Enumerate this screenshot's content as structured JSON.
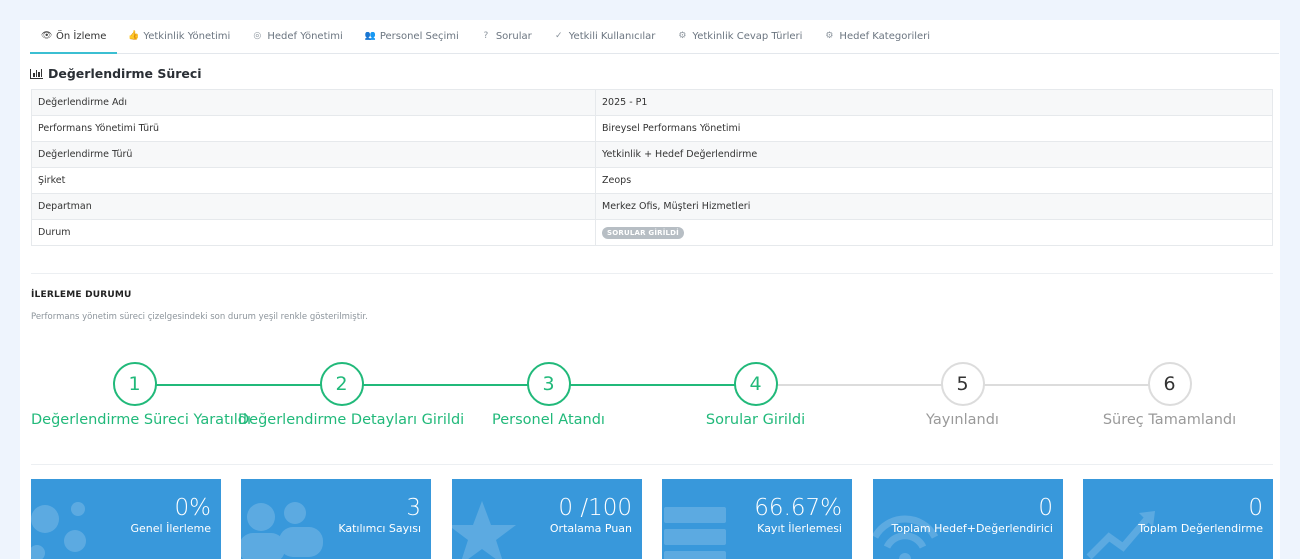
{
  "tabs": [
    {
      "label": "Ön İzleme",
      "icon": "eye-icon",
      "glyph": "👁",
      "active": true
    },
    {
      "label": "Yetkinlik Yönetimi",
      "icon": "thumbs-up-icon",
      "glyph": "👍"
    },
    {
      "label": "Hedef Yönetimi",
      "icon": "target-icon",
      "glyph": "◎"
    },
    {
      "label": "Personel Seçimi",
      "icon": "users-icon",
      "glyph": "👥"
    },
    {
      "label": "Sorular",
      "icon": "question-icon",
      "glyph": "?"
    },
    {
      "label": "Yetkili Kullanıcılar",
      "icon": "check-circle-icon",
      "glyph": "✓"
    },
    {
      "label": "Yetkinlik Cevap Türleri",
      "icon": "gear-icon",
      "glyph": "⚙"
    },
    {
      "label": "Hedef Kategorileri",
      "icon": "gear-icon",
      "glyph": "⚙"
    }
  ],
  "section_title": "Değerlendirme Süreci",
  "info_rows": [
    {
      "key": "Değerlendirme Adı",
      "value": "2025 - P1"
    },
    {
      "key": "Performans Yönetimi Türü",
      "value": "Bireysel Performans Yönetimi"
    },
    {
      "key": "Değerlendirme Türü",
      "value": "Yetkinlik + Hedef Değerlendirme"
    },
    {
      "key": "Şirket",
      "value": "Zeops"
    },
    {
      "key": "Departman",
      "value": "Merkez Ofis, Müşteri Hizmetleri"
    },
    {
      "key": "Durum",
      "value": "SORULAR GİRİLDİ"
    }
  ],
  "progress": {
    "title": "İLERLEME DURUMU",
    "description": "Performans yönetim süreci çizelgesindeki son durum yeşil renkle gösterilmiştir.",
    "steps": [
      {
        "number": "1",
        "label": "Değerlendirme Süreci Yaratıldı",
        "done": true
      },
      {
        "number": "2",
        "label": "Değerlendirme Detayları Girildi",
        "done": true
      },
      {
        "number": "3",
        "label": "Personel Atandı",
        "done": true
      },
      {
        "number": "4",
        "label": "Sorular Girildi",
        "done": true
      },
      {
        "number": "5",
        "label": "Yayınlandı",
        "done": false
      },
      {
        "number": "6",
        "label": "Süreç Tamamlandı",
        "done": false
      }
    ]
  },
  "stats": [
    {
      "value": "0%",
      "label": "Genel İlerleme",
      "icon": "dots-icon"
    },
    {
      "value": "3",
      "label": "Katılımcı Sayısı",
      "icon": "users-icon"
    },
    {
      "value": "0 /100",
      "label": "Ortalama Puan",
      "icon": "star-icon"
    },
    {
      "value": "66.67%",
      "label": "Kayıt İlerlemesi",
      "icon": "server-icon"
    },
    {
      "value": "0",
      "label": "Toplam Hedef+Değerlendirici",
      "icon": "wifi-icon"
    },
    {
      "value": "0",
      "label": "Toplam Değerlendirme",
      "icon": "chart-icon"
    }
  ],
  "colors": {
    "accent": "#3bbfd2",
    "done": "#21b97a",
    "todo": "#dcdcdc",
    "card": "#3898db"
  }
}
